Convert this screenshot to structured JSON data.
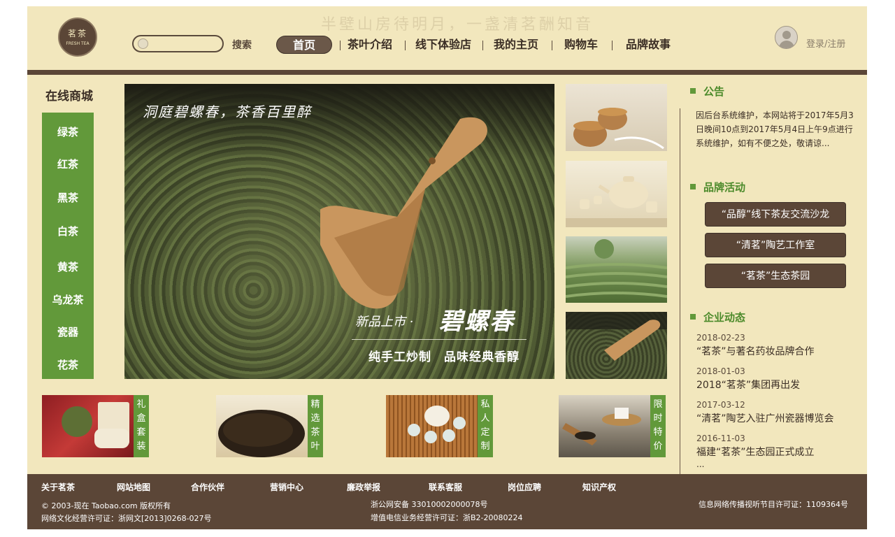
{
  "header": {
    "logo_text": "茗茶",
    "logo_sub": "FRESH TEA",
    "slogan": "半壁山房待明月，一盏清茗酬知音",
    "search_placeholder": "",
    "search_label": "搜索",
    "nav": [
      "首页",
      "茶叶介绍",
      "线下体验店",
      "我的主页",
      "购物车",
      "品牌故事"
    ],
    "login_label": "登录/注册"
  },
  "sidebar": {
    "title": "在线商城",
    "categories": [
      "绿茶",
      "红茶",
      "黑茶",
      "白茶",
      "黄茶",
      "乌龙茶",
      "瓷器",
      "花茶"
    ]
  },
  "banner": {
    "heading": "洞庭碧螺春，茶香百里醉",
    "tag": "新品上市 ·",
    "name": "碧螺春",
    "subtitle": "纯手工炒制　品味经典香醇"
  },
  "products": [
    "礼盒套装",
    "精选茶叶",
    "私人定制",
    "限时特价"
  ],
  "notice": {
    "title": "公告",
    "text": "因后台系统维护，本网站将于2017年5月3日晚间10点到2017年5月4日上午9点进行系统维护，如有不便之处，敬请谅..."
  },
  "activities": {
    "title": "品牌活动",
    "items": [
      "“品醇”线下茶友交流沙龙",
      "“清茗”陶艺工作室",
      "“茗茶”生态茶园"
    ]
  },
  "news": {
    "title": "企业动态",
    "items": [
      {
        "date": "2018-02-23",
        "title": "“茗茶”与著名药妆品牌合作"
      },
      {
        "date": "2018-01-03",
        "title": "2018“茗茶”集团再出发"
      },
      {
        "date": "2017-03-12",
        "title": "“清茗”陶艺入驻广州瓷器博览会"
      },
      {
        "date": "2016-11-03",
        "title": "福建“茗茶”生态园正式成立"
      }
    ],
    "more": "..."
  },
  "footer": {
    "links": [
      "关于茗茶",
      "网站地图",
      "合作伙伴",
      "营销中心",
      "廉政举报",
      "联系客服",
      "岗位应聘",
      "知识产权"
    ],
    "copyright": "© 2003-现在 Taobao.com 版权所有",
    "license": "网络文化经营许可证：浙网文[2013]0268-027号",
    "icp": "浙公网安备 33010002000078号",
    "telecom": "增值电信业务经营许可证：浙B2-20080224",
    "av_license": "信息网络传播视听节目许可证：1109364号"
  },
  "colors": {
    "background": "#f2e7bd",
    "brown": "#5b4637",
    "green": "#62993a",
    "heading_green": "#4b8a2a"
  }
}
